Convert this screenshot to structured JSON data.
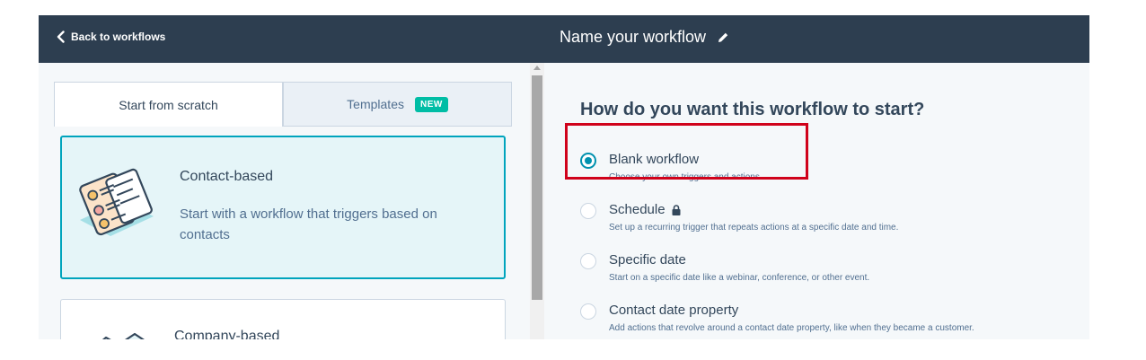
{
  "header": {
    "back_label": "Back to workflows",
    "workflow_name": "Name your workflow"
  },
  "tabs": [
    {
      "label": "Start from scratch"
    },
    {
      "label": "Templates",
      "badge": "NEW"
    }
  ],
  "cards": [
    {
      "title": "Contact-based",
      "description": "Start with a workflow that triggers based on contacts"
    },
    {
      "title": "Company-based"
    }
  ],
  "right_panel": {
    "question": "How do you want this workflow to start?",
    "options": [
      {
        "title": "Blank workflow",
        "description": "Choose your own triggers and actions.",
        "selected": true
      },
      {
        "title": "Schedule",
        "description": "Set up a recurring trigger that repeats actions at a specific date and time.",
        "locked": true
      },
      {
        "title": "Specific date",
        "description": "Start on a specific date like a webinar, conference, or other event."
      },
      {
        "title": "Contact date property",
        "description": "Add actions that revolve around a contact date property, like when they became a customer."
      }
    ]
  },
  "colors": {
    "header_bg": "#2d3e50",
    "accent": "#00a4bd",
    "radio_selected": "#0091ae",
    "badge": "#00bda5",
    "highlight": "#d0021b"
  },
  "icons": [
    "chevron-left-icon",
    "pencil-icon",
    "lock-icon",
    "contact-card-illustration",
    "company-building-illustration"
  ]
}
